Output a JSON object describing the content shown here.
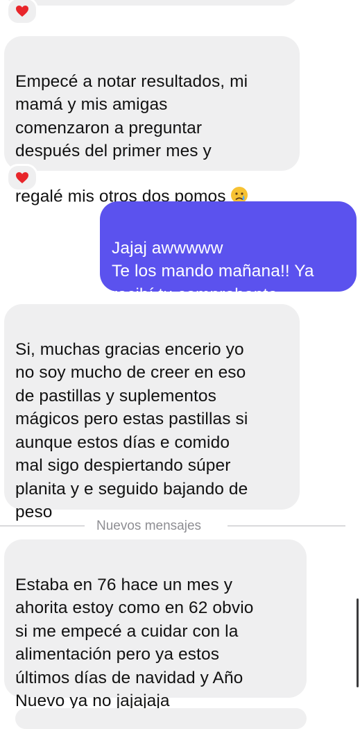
{
  "messages": {
    "m0": {
      "reaction": "heart"
    },
    "m1": {
      "text": "Empecé a notar resultados, mi\nmamá y mis amigas\ncomenzaron a preguntar\ndespués del primer mes y\nregalé mis otros dos pomos",
      "emoji": "crying-face",
      "reaction": "heart"
    },
    "m2": {
      "text": "Jajaj awwwww\nTe los mando mañana!! Ya\nrecibí tu comprobante"
    },
    "m3": {
      "text": "Si, muchas gracias encerio yo\nno soy mucho de creer en eso\nde pastillas y suplementos\nmágicos pero estas pastillas si\naunque estos días e comido\nmal sigo despiertando súper\nplanita y e seguido bajando de\npeso"
    },
    "m4": {
      "text": "Estaba en 76 hace un mes y\nahorita estoy como en 62 obvio\nsi me empecé a cuidar con la\nalimentación pero ya estos\núltimos días de navidad y Año\nNuevo ya no jajajaja"
    }
  },
  "divider": {
    "label": "Nuevos mensajes"
  },
  "colors": {
    "incoming_bubble": "#efeff0",
    "outgoing_bubble": "#5b52ee",
    "heart": "#e8262b"
  }
}
